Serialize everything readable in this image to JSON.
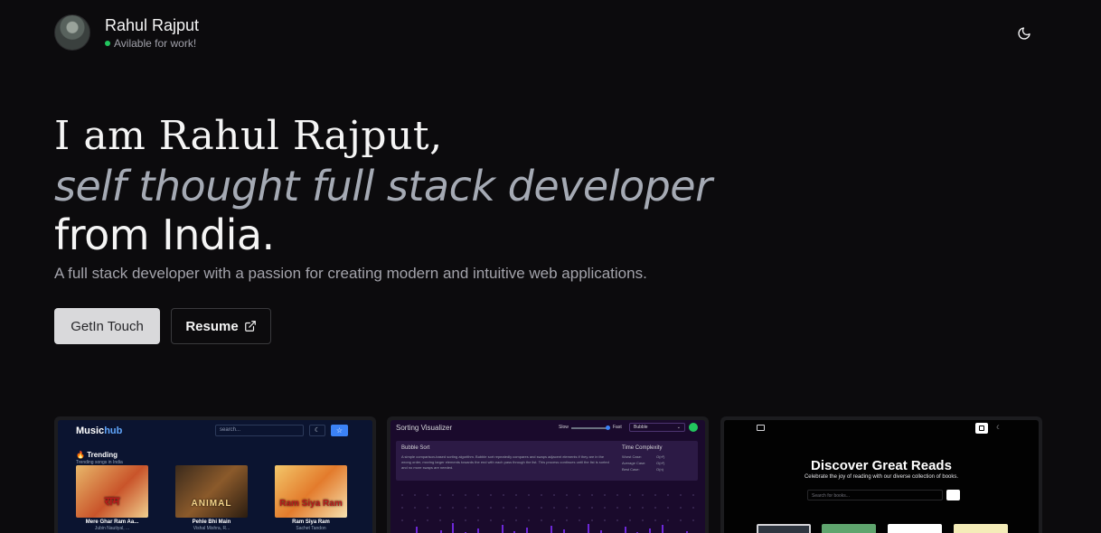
{
  "profile": {
    "name": "Rahul Rajput",
    "status": "Avilable for work!",
    "status_color": "#22c55e"
  },
  "header": {
    "theme_icon": "moon-icon"
  },
  "hero": {
    "line1": "I am Rahul Rajput,",
    "line2": "self thought full stack developer",
    "line3": "from India.",
    "subtitle": "A full stack developer with a passion for creating modern and intuitive web applications."
  },
  "buttons": {
    "get_in_touch": "GetIn Touch",
    "resume": "Resume",
    "resume_icon": "external-link-icon"
  },
  "projects": {
    "music": {
      "logo_a": "Music",
      "logo_b": "hub",
      "search_placeholder": "search...",
      "section": "Trending",
      "section_sub": "Trending songs in India",
      "songs": [
        {
          "art": "राम",
          "title": "Mere Ghar Ram Aa...",
          "artist": "Jubin Nautiyal, ..."
        },
        {
          "art": "ANIMAL",
          "title": "Pehle Bhi Main",
          "artist": "Vishal Mishra, R..."
        },
        {
          "art": "Ram Siya Ram",
          "title": "Ram Siya Ram",
          "artist": "Sachet Tandon"
        }
      ]
    },
    "sorting": {
      "title": "Sorting Visualizer",
      "slow": "Slow",
      "fast": "Fast",
      "algorithm": "Bubble",
      "algo_title": "Bubble Sort",
      "description": "A simple comparison-based sorting algorithm. Bubble sort repeatedly compares and swaps adjacent elements if they are in the wrong order, moving larger elements towards the end with each pass through the list. This process continues until the list is sorted and no more swaps are needed.",
      "complexity_title": "Time Complexity",
      "complexity": [
        {
          "label": "Worst Case:",
          "value": "O(n²)"
        },
        {
          "label": "Average Case:",
          "value": "O(n²)"
        },
        {
          "label": "Best Case:",
          "value": "O(n)"
        }
      ]
    },
    "books": {
      "title": "Discover Great Reads",
      "subtitle": "Celebrate the joy of reading with our diverse collection of books.",
      "search_placeholder": "Search for books..."
    }
  }
}
